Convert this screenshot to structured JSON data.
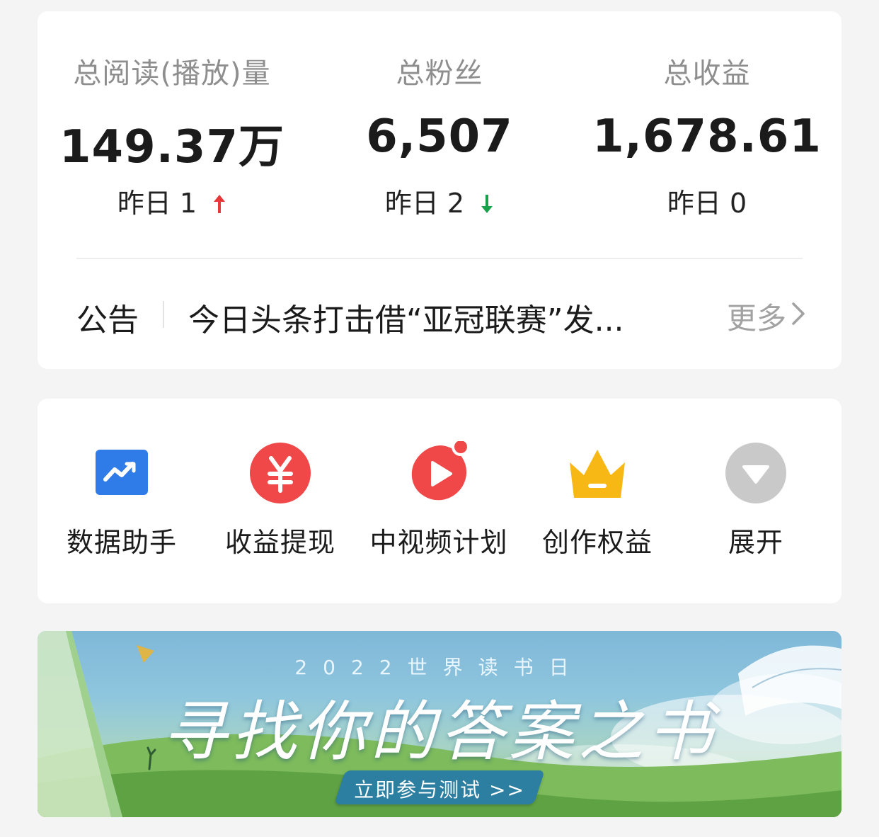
{
  "stats": [
    {
      "label": "总阅读(播放)量",
      "value": "149.37万",
      "yesterday": "昨日 1",
      "trend": "up",
      "trend_color": "#e8393a"
    },
    {
      "label": "总粉丝",
      "value": "6,507",
      "yesterday": "昨日 2",
      "trend": "down",
      "trend_color": "#1aa04a"
    },
    {
      "label": "总收益",
      "value": "1,678.61",
      "yesterday": "昨日 0",
      "trend": "none"
    }
  ],
  "notice": {
    "label": "公告",
    "text": "今日头条打击借“亚冠联赛”发...",
    "more": "更多"
  },
  "tools": [
    {
      "label": "数据助手",
      "icon": "data-chart-icon"
    },
    {
      "label": "收益提现",
      "icon": "yuan-icon"
    },
    {
      "label": "中视频计划",
      "icon": "video-play-icon",
      "badge": true
    },
    {
      "label": "创作权益",
      "icon": "crown-icon"
    },
    {
      "label": "展开",
      "icon": "expand-down-icon"
    }
  ],
  "banner": {
    "year_text": "2022世界读书日",
    "title": "寻找你的答案之书",
    "button": "立即参与测试 >>"
  },
  "colors": {
    "up": "#e8393a",
    "down": "#1aa04a",
    "accent_red": "#f04848",
    "accent_blue": "#2f7be8",
    "crown": "#f7b816"
  }
}
